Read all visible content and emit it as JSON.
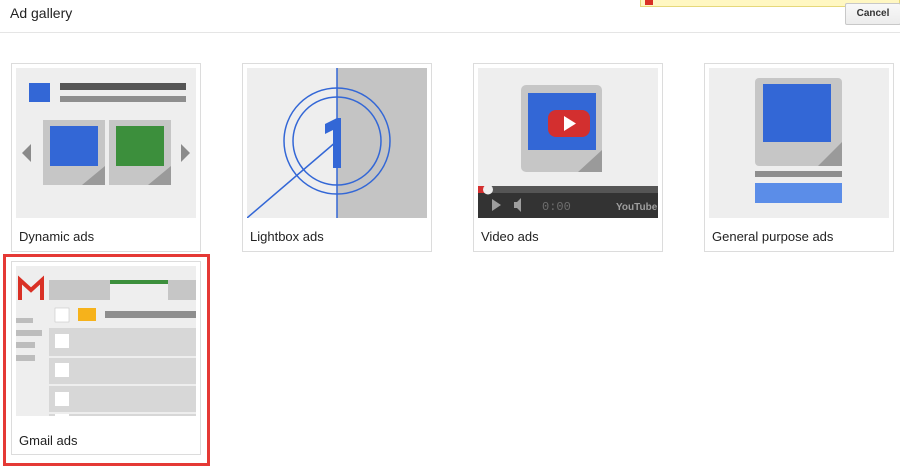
{
  "header": {
    "title": "Ad gallery",
    "cancel_label": "Cancel"
  },
  "gallery": {
    "items": [
      {
        "label": "Dynamic ads",
        "icon": "dynamic-ads-thumbnail"
      },
      {
        "label": "Lightbox ads",
        "icon": "lightbox-ads-thumbnail"
      },
      {
        "label": "Video ads",
        "icon": "video-ads-thumbnail",
        "player_time": "0:00",
        "player_brand": "YouTube"
      },
      {
        "label": "General purpose ads",
        "icon": "general-purpose-ads-thumbnail"
      },
      {
        "label": "Gmail ads",
        "icon": "gmail-ads-thumbnail",
        "selected": true
      }
    ]
  },
  "colors": {
    "blue": "#3367d6",
    "green": "#3c8f3c",
    "red": "#e53935",
    "yellow": "#f6b21b",
    "gray": "#bdbdbd"
  }
}
